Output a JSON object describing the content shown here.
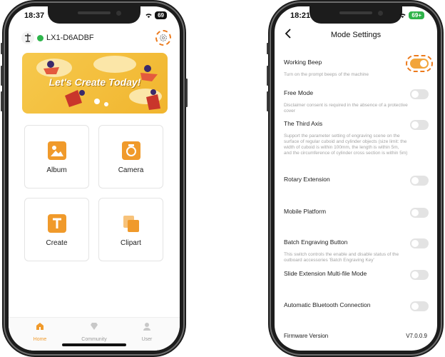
{
  "left_phone": {
    "status": {
      "time": "18:37",
      "battery": "69"
    },
    "device_name": "LX1-D6ADBF",
    "banner_title": "Let's Create Today!",
    "grid": [
      {
        "label": "Album",
        "icon": "image-icon"
      },
      {
        "label": "Camera",
        "icon": "camera-icon"
      },
      {
        "label": "Create",
        "icon": "text-icon"
      },
      {
        "label": "Clipart",
        "icon": "clipart-icon"
      }
    ],
    "tabs": [
      {
        "label": "Home",
        "icon": "home-icon",
        "active": true
      },
      {
        "label": "Community",
        "icon": "diamond-icon",
        "active": false
      },
      {
        "label": "User",
        "icon": "user-icon",
        "active": false
      }
    ]
  },
  "right_phone": {
    "status": {
      "time": "18:21",
      "battery": "69+"
    },
    "title": "Mode Settings",
    "settings": [
      {
        "title": "Working Beep",
        "desc": "Turn on the prompt beeps of the machine",
        "on": true
      },
      {
        "title": "Free Mode",
        "desc": "Disclaimer consent is required in the absence of a protective cover",
        "on": false
      },
      {
        "title": "The Third Axis",
        "desc": "Support the parameter setting of engraving scene on the surface of regular cuboid and cylinder objects (size limit: the width of cuboid is within 100mm, the length is within 5m, and the circumference of cylinder cross section is within 5m)",
        "on": false
      },
      {
        "title": "Rotary Extension",
        "desc": "",
        "on": false
      },
      {
        "title": "Mobile Platform",
        "desc": "",
        "on": false
      },
      {
        "title": "Batch Engraving Button",
        "desc": "This switch controls the enable and disable status of the outboard accessories 'Batch Engraving Key'",
        "on": false
      },
      {
        "title": "Slide Extension Multi-file Mode",
        "desc": "",
        "on": false
      },
      {
        "title": "Automatic Bluetooth Connection",
        "desc": "",
        "on": false
      }
    ],
    "firmware": {
      "label": "Firmware Version",
      "value": "V7.0.0.9"
    }
  },
  "colors": {
    "accent": "#f09a2b",
    "highlight": "#ec7a1c",
    "connected": "#2db54b"
  }
}
